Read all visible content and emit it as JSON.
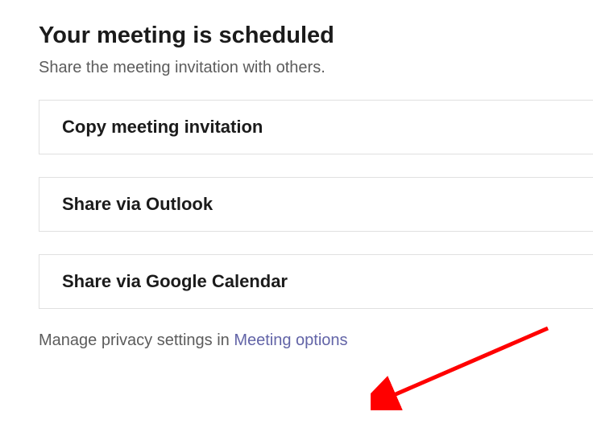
{
  "header": {
    "title": "Your meeting is scheduled",
    "subtitle": "Share the meeting invitation with others."
  },
  "buttons": {
    "copy_label": "Copy meeting invitation",
    "outlook_label": "Share via Outlook",
    "google_label": "Share via Google Calendar"
  },
  "footer": {
    "text": "Manage privacy settings in ",
    "link_text": "Meeting options"
  },
  "annotation": {
    "arrow_color": "#ff0000"
  }
}
